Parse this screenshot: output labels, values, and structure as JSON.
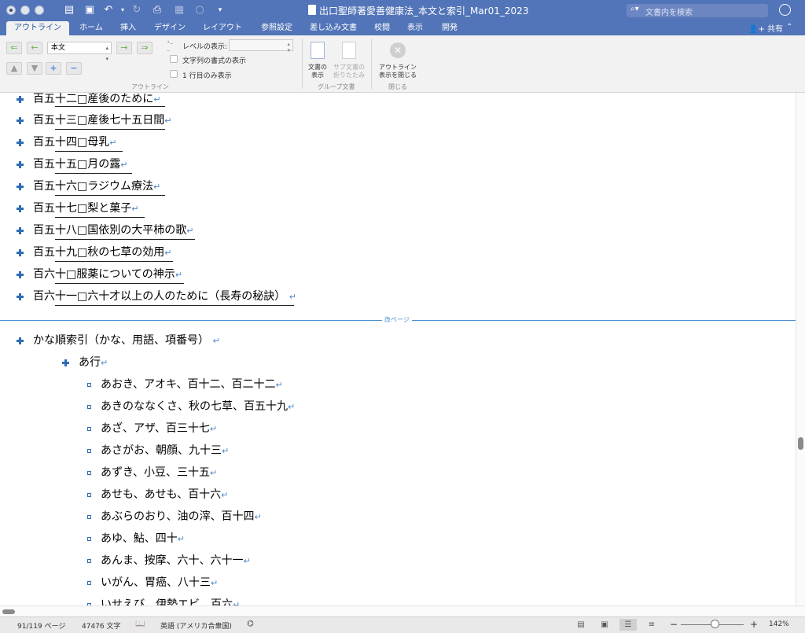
{
  "window": {
    "title": "出口聖師著愛善健康法_本文と索引_Mar01_2023",
    "search_placeholder": "文書内を検索"
  },
  "tabs": [
    {
      "label": "アウトライン"
    },
    {
      "label": "ホーム"
    },
    {
      "label": "挿入"
    },
    {
      "label": "デザイン"
    },
    {
      "label": "レイアウト"
    },
    {
      "label": "参照設定"
    },
    {
      "label": "差し込み文書"
    },
    {
      "label": "校閲"
    },
    {
      "label": "表示"
    },
    {
      "label": "開発"
    }
  ],
  "share_label": "共有",
  "ribbon": {
    "style_select": "本文",
    "level_label": "レベルの表示:",
    "show_text_format": "文字列の書式の表示",
    "show_first_line": "1 行目のみ表示",
    "outline_group": "アウトライン",
    "show_document": "文書の\n表示",
    "collapse_subdocs": "サブ文書の\n折りたたみ",
    "group_doc_label": "グループ文書",
    "close_outline": "アウトライン\n表示を閉じる",
    "close_group_label": "閉じる"
  },
  "outline": {
    "top_items": [
      "百五十二□産後のために",
      "百五十三□産後七十五日間",
      "百五十四□母乳",
      "百五十五□月の露",
      "百五十六□ラジウム療法",
      "百五十七□梨と菓子",
      "百五十八□国依別の大平柿の歌",
      "百五十九□秋の七草の効用",
      "百六十□服薬についての神示",
      "百六十一□六十才以上の人のために（長寿の秘訣）"
    ],
    "page_break_label": "改ページ",
    "index_heading": "かな順索引（かな、用語、項番号）",
    "section_heading": "あ行",
    "index_items": [
      "あおき、アオキ、百十二、百二十二",
      "あきのななくさ、秋の七草、百五十九",
      "あざ、アザ、百三十七",
      "あさがお、朝顔、九十三",
      "あずき、小豆、三十五",
      "あせも、あせも、百十六",
      "あぶらのおり、油の滓、百十四",
      "あゆ、鮎、四十",
      "あんま、按摩、六十、六十一",
      "いがん、胃癌、八十三",
      "いせえび、伊勢エビ、百六"
    ]
  },
  "status": {
    "page": "91/119 ページ",
    "words": "47476 文字",
    "language": "英語 (アメリカ合衆国)",
    "zoom": "142%"
  }
}
